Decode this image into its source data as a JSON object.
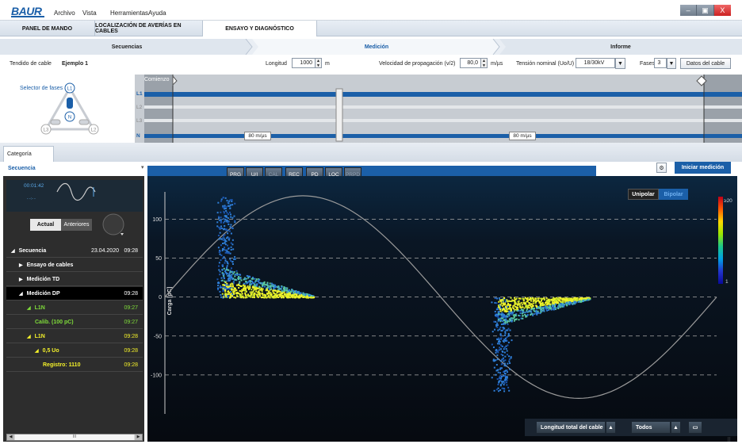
{
  "app": {
    "logo": "BAUR"
  },
  "menu": [
    "Archivo",
    "Vista",
    "Herramientas",
    "Ayuda"
  ],
  "window_controls": {
    "minimize": "–",
    "restore": "▣",
    "close": "X"
  },
  "tabs": [
    {
      "label": "PANEL DE MANDO",
      "active": false
    },
    {
      "label": "LOCALIZACIÓN DE AVERÍAS EN CABLES",
      "active": false
    },
    {
      "label": "ENSAYO Y DIAGNÓSTICO",
      "active": true
    }
  ],
  "steps": [
    {
      "label": "Secuencias",
      "active": false
    },
    {
      "label": "Medición",
      "active": true
    },
    {
      "label": "Informe",
      "active": false
    }
  ],
  "params": {
    "cable_label": "Tendido de cable",
    "cable_value": "Ejemplo 1",
    "length_label": "Longitud",
    "length_value": "1000",
    "length_unit": "m",
    "velocity_label": "Velocidad de propagación (v/2)",
    "velocity_value": "80,0",
    "velocity_unit": "m/µs",
    "voltage_label": "Tensión nominal (Uo/U)",
    "voltage_value": "18/30kV",
    "phases_label": "Fases",
    "phases_value": "3",
    "cable_data_button": "Datos del cable"
  },
  "phase_selector": {
    "title": "Selector de fases",
    "nodes": [
      "L1",
      "N",
      "L3",
      "L2"
    ],
    "lines": [
      "L1",
      "L2",
      "L3",
      "N"
    ],
    "start_label": "Comienzo",
    "speed_left": "80 m/µs",
    "speed_right": "80 m/µs"
  },
  "category": {
    "tab": "Categoría",
    "selected": "Secuencia"
  },
  "left_panel": {
    "thumb_time": "00:01:42",
    "thumb_sub": "- -:- -",
    "view_tabs": [
      "Actual",
      "Anteriores"
    ],
    "tree": [
      {
        "label": "Secuencia",
        "date": "23.04.2020",
        "time": "09:28",
        "color": "white",
        "indent": 0,
        "arrow": "◢"
      },
      {
        "label": "Ensayo de cables",
        "time": "",
        "color": "white",
        "indent": 1,
        "arrow": "▶"
      },
      {
        "label": "Medición TD",
        "time": "",
        "color": "white",
        "indent": 1,
        "arrow": "▶"
      },
      {
        "label": "Medición DP",
        "time": "09:28",
        "color": "white",
        "indent": 1,
        "arrow": "◢"
      },
      {
        "label": "L1N",
        "time": "09:27",
        "color": "green",
        "indent": 2,
        "arrow": "◢"
      },
      {
        "label": "Calib. (100 pC)",
        "time": "09:27",
        "color": "green",
        "indent": 3,
        "arrow": ""
      },
      {
        "label": "L1N",
        "time": "09:28",
        "color": "yellow",
        "indent": 2,
        "arrow": "◢"
      },
      {
        "label": "0,5 Uo",
        "time": "09:28",
        "color": "yellow",
        "indent": 3,
        "arrow": "◢"
      },
      {
        "label": "Registro: 1110",
        "time": "09:28",
        "color": "yellow",
        "indent": 4,
        "arrow": ""
      }
    ],
    "scroll_mid": "III"
  },
  "plot_buttons": [
    "PRG",
    "U/I",
    "CAL",
    "REC",
    "PD",
    "LOC",
    "PRPD"
  ],
  "start_button": "Iniciar medición",
  "plot_mode": {
    "options": [
      "Unipolar",
      "Bipolar"
    ],
    "selected": "Unipolar"
  },
  "colorbar": {
    "max_label": "≥20",
    "min_label": "1"
  },
  "bottom": {
    "length_select": "Longitud total del cable",
    "filter_select": "Todos"
  },
  "chart_data": {
    "type": "scatter",
    "title": "",
    "xlabel": "",
    "ylabel": "Carga [pC]",
    "yticks": [
      100,
      50,
      0,
      -50,
      -100
    ],
    "ylim": [
      -150,
      135
    ],
    "xlim": [
      0,
      360
    ],
    "grid": true,
    "reference_curve": "sine",
    "clusters": [
      {
        "x_range": [
          30,
          95
        ],
        "y_range": [
          0,
          135
        ],
        "peak_x": 35,
        "peak_y": 130,
        "tail_x": 95
      },
      {
        "x_range": [
          210,
          275
        ],
        "y_range": [
          -125,
          0
        ],
        "peak_x": 215,
        "peak_y": -120,
        "tail_x": 275
      }
    ],
    "colorbar_range": [
      1,
      20
    ]
  }
}
